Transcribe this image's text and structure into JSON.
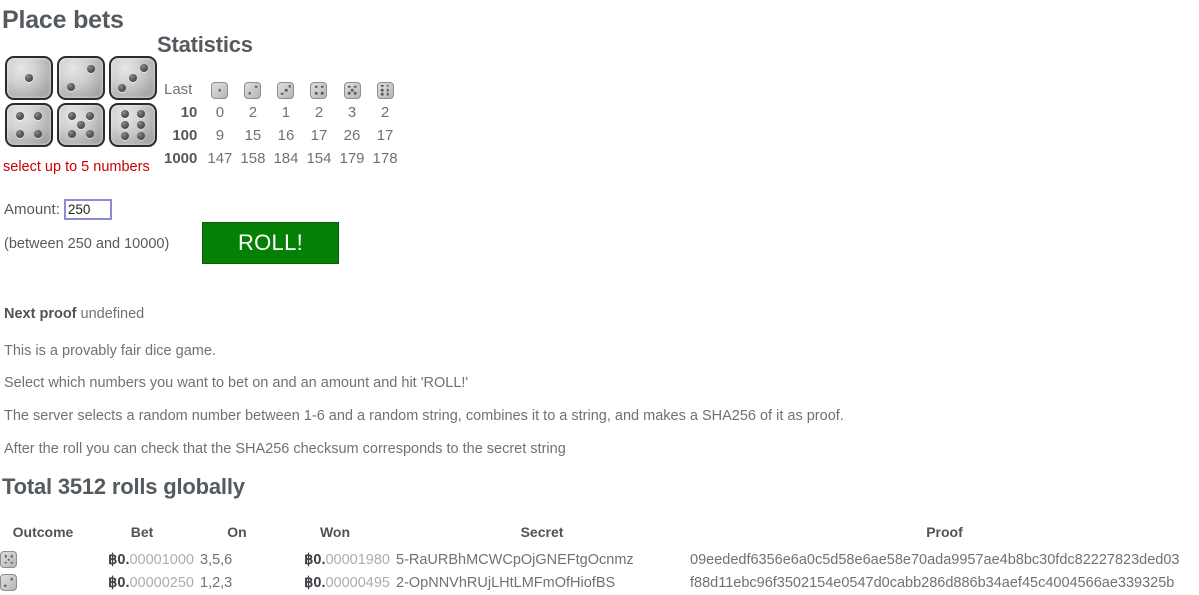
{
  "headings": {
    "place_bets": "Place bets",
    "statistics": "Statistics",
    "total_rolls": "Total 3512 rolls globally"
  },
  "dice_selector": {
    "faces": [
      1,
      2,
      3,
      4,
      5,
      6
    ],
    "warning": "select up to 5 numbers"
  },
  "stats": {
    "last_label": "Last",
    "face_icons": [
      "die-1-icon",
      "die-2-icon",
      "die-3-icon",
      "die-4-icon",
      "die-5-icon",
      "die-6-icon"
    ],
    "rows": [
      {
        "label": "10",
        "values": [
          "0",
          "2",
          "1",
          "2",
          "3",
          "2"
        ]
      },
      {
        "label": "100",
        "values": [
          "9",
          "15",
          "16",
          "17",
          "26",
          "17"
        ]
      },
      {
        "label": "1000",
        "values": [
          "147",
          "158",
          "184",
          "154",
          "179",
          "178"
        ]
      }
    ]
  },
  "form": {
    "amount_label": "Amount:",
    "amount_value": "250",
    "between_note": "(between 250 and 10000)",
    "roll_label": "ROLL!",
    "roll_color": "#048104",
    "input_border_color": "#8b8bd6"
  },
  "proof": {
    "label": "Next proof",
    "value": "undefined"
  },
  "description": [
    "This is a provably fair dice game.",
    "Select which numbers you want to bet on and an amount and hit 'ROLL!'",
    "The server selects a random number between 1-6 and a random string, combines it to a string, and makes a SHA256 of it as proof.",
    "After the roll you can check that the SHA256 checksum corresponds to the secret string"
  ],
  "table": {
    "columns": [
      "Outcome",
      "Bet",
      "On",
      "Won",
      "Secret",
      "Proof"
    ],
    "rows": [
      {
        "outcome_face": 5,
        "bet_lead": "฿0.",
        "bet_tail": "00001000",
        "on": "3,5,6",
        "won_lead": "฿0.",
        "won_tail": "00001980",
        "secret": "5-RaURBhMCWCpOjGNEFtgOcnmz",
        "proof": "09eededf6356e6a0c5d58e6ae58e70ada9957ae4b8bc30fdc82227823ded03"
      },
      {
        "outcome_face": 2,
        "bet_lead": "฿0.",
        "bet_tail": "00000250",
        "on": "1,2,3",
        "won_lead": "฿0.",
        "won_tail": "00000495",
        "secret": "2-OpNNVhRUjLHtLMFmOfHiofBS",
        "proof": "f88d11ebc96f3502154e0547d0cabb286d886b34aef45c4004566ae339325b"
      }
    ]
  }
}
